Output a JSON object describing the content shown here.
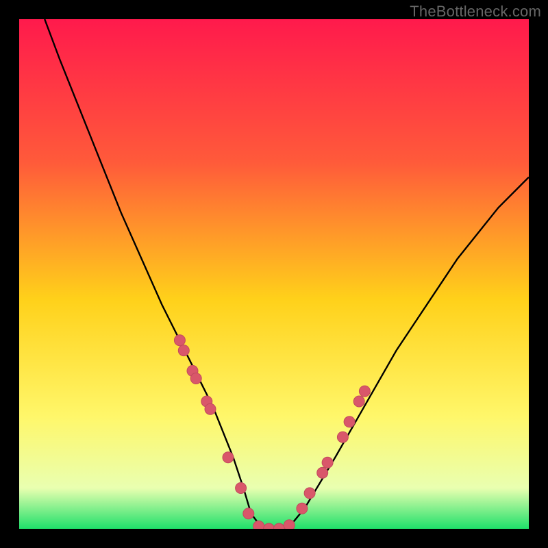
{
  "watermark": "TheBottleneck.com",
  "colors": {
    "bg": "#000000",
    "grad_top": "#ff1a4c",
    "grad_upper": "#ff5a3a",
    "grad_mid": "#ffd11a",
    "grad_lower": "#fff76a",
    "grad_pale": "#e9ffb0",
    "grad_bottom": "#1fe06a",
    "curve": "#000000",
    "dot_fill": "#d9576a",
    "dot_stroke": "#c24a5d"
  },
  "chart_data": {
    "type": "line",
    "title": "",
    "xlabel": "",
    "ylabel": "",
    "xlim": [
      0,
      100
    ],
    "ylim": [
      0,
      100
    ],
    "legend": null,
    "grid": false,
    "series": [
      {
        "name": "bottleneck-curve",
        "x": [
          5,
          8,
          12,
          16,
          20,
          24,
          28,
          32,
          35,
          38,
          40,
          42,
          44,
          45.5,
          47,
          49,
          51,
          53.5,
          56,
          59,
          62,
          66,
          70,
          74,
          78,
          82,
          86,
          90,
          94,
          98,
          100
        ],
        "y": [
          100,
          92,
          82,
          72,
          62,
          53,
          44,
          36,
          30,
          24,
          19,
          14,
          8,
          3,
          1,
          0,
          0,
          1,
          4,
          9,
          14,
          21,
          28,
          35,
          41,
          47,
          53,
          58,
          63,
          67,
          69
        ]
      }
    ],
    "markers": [
      {
        "name": "left-dots",
        "x": [
          31.5,
          32.3,
          34.0,
          34.7,
          36.8,
          37.5,
          41.0,
          43.5,
          45.0
        ],
        "y": [
          37,
          35,
          31,
          29.5,
          25,
          23.5,
          14,
          8,
          3
        ]
      },
      {
        "name": "valley-dots",
        "x": [
          47,
          49,
          51,
          53
        ],
        "y": [
          0.5,
          0,
          0,
          0.7
        ]
      },
      {
        "name": "right-dots",
        "x": [
          55.5,
          57.0,
          59.5,
          60.5,
          63.5,
          64.8,
          66.7,
          67.8
        ],
        "y": [
          4,
          7,
          11,
          13,
          18,
          21,
          25,
          27
        ]
      }
    ]
  }
}
